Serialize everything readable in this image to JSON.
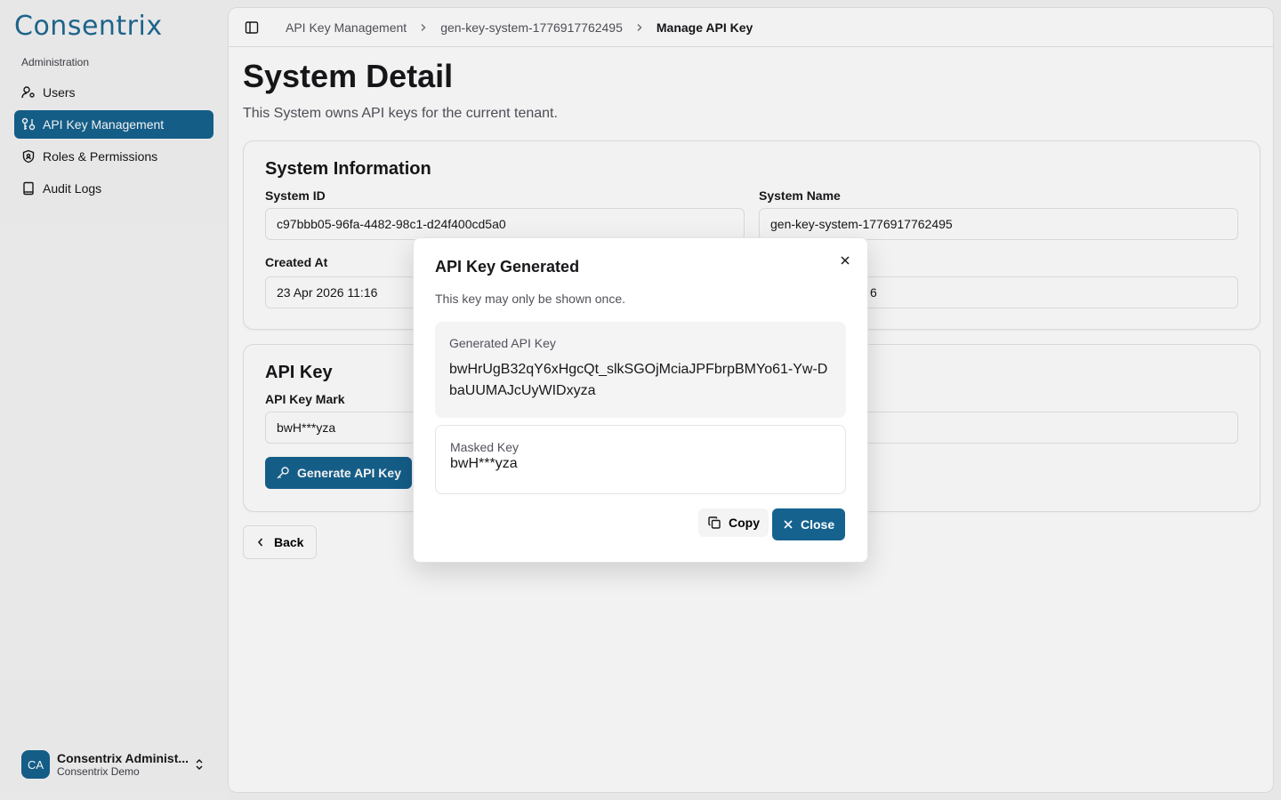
{
  "brand": {
    "logo_text": "Consentrix",
    "primary_color": "#16628f"
  },
  "sidebar": {
    "section_label": "Administration",
    "items": [
      {
        "label": "Users",
        "icon": "user-cog-icon",
        "active": false
      },
      {
        "label": "API Key Management",
        "icon": "key-management-icon",
        "active": true
      },
      {
        "label": "Roles & Permissions",
        "icon": "shield-icon",
        "active": false
      },
      {
        "label": "Audit Logs",
        "icon": "book-icon",
        "active": false
      }
    ],
    "user": {
      "initials": "CA",
      "name": "Consentrix Administ...",
      "org": "Consentrix Demo"
    }
  },
  "breadcrumb": {
    "items": [
      "API Key Management",
      "gen-key-system-1776917762495",
      "Manage API Key"
    ]
  },
  "page": {
    "title": "System Detail",
    "subtitle": "This System owns API keys for the current tenant."
  },
  "system_info": {
    "title": "System Information",
    "system_id_label": "System ID",
    "system_id_value": "c97bbb05-96fa-4482-98c1-d24f400cd5a0",
    "system_name_label": "System Name",
    "system_name_value": "gen-key-system-1776917762495",
    "created_at_label": "Created At",
    "created_at_value": "23 Apr 2026 11:16",
    "right_partial_value": "6"
  },
  "api_key": {
    "title": "API Key",
    "mark_label": "API Key Mark",
    "mark_value": "bwH***yza",
    "generate_label": "Generate API Key"
  },
  "back_label": "Back",
  "modal": {
    "title": "API Key Generated",
    "description": "This key may only be shown once.",
    "generated_label": "Generated API Key",
    "generated_value": "bwHrUgB32qY6xHgcQt_slkSGOjMciaJPFbrpBMYo61-Yw-DbaUUMAJcUyWIDxyza",
    "masked_label": "Masked Key",
    "masked_value": "bwH***yza",
    "copy_label": "Copy",
    "close_label": "Close"
  }
}
